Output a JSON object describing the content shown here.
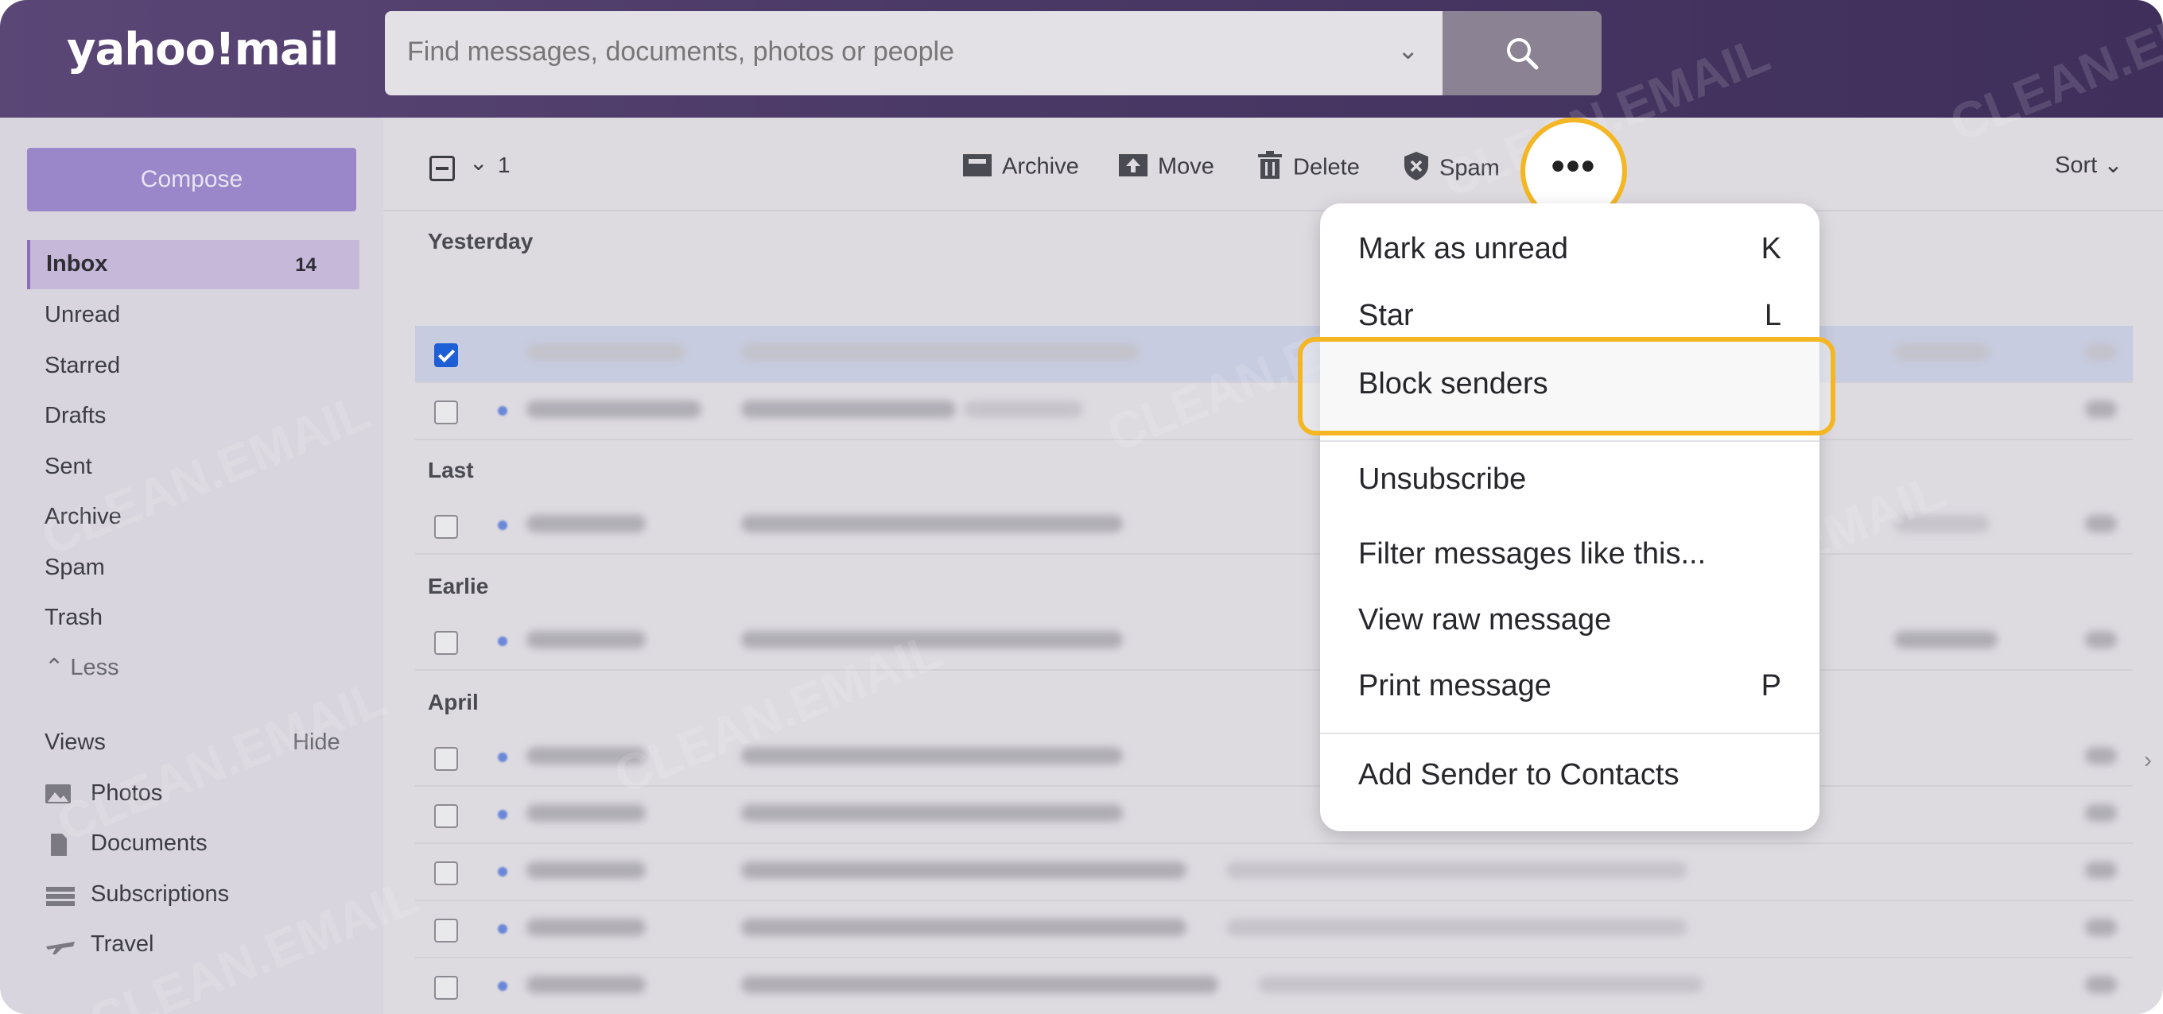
{
  "header": {
    "logo": "yahoo!mail",
    "search_placeholder": "Find messages, documents, photos or people"
  },
  "sidebar": {
    "compose": "Compose",
    "inbox": {
      "label": "Inbox",
      "count": "14"
    },
    "folders": [
      "Unread",
      "Starred",
      "Drafts",
      "Sent",
      "Archive",
      "Spam",
      "Trash"
    ],
    "less": "Less",
    "views_label": "Views",
    "hide": "Hide",
    "views": [
      {
        "label": "Photos",
        "icon": "photos-icon"
      },
      {
        "label": "Documents",
        "icon": "document-icon"
      },
      {
        "label": "Subscriptions",
        "icon": "subscriptions-icon"
      },
      {
        "label": "Travel",
        "icon": "plane-icon"
      }
    ]
  },
  "toolbar": {
    "selected_count": "1",
    "archive": "Archive",
    "move": "Move",
    "delete": "Delete",
    "spam": "Spam",
    "more": "•••",
    "sort": "Sort"
  },
  "groups": [
    "Yesterday",
    "Last",
    "Earlie",
    "April"
  ],
  "menu": {
    "items": [
      {
        "label": "Mark as unread",
        "shortcut": "K"
      },
      {
        "label": "Star",
        "shortcut": "L"
      },
      {
        "label": "Block senders",
        "shortcut": ""
      },
      {
        "label": "Unsubscribe",
        "shortcut": ""
      },
      {
        "label": "Filter messages like this...",
        "shortcut": ""
      },
      {
        "label": "View raw message",
        "shortcut": ""
      },
      {
        "label": "Print message",
        "shortcut": "P"
      },
      {
        "label": "Add Sender to Contacts",
        "shortcut": ""
      }
    ]
  },
  "watermark": "CLEAN.EMAIL",
  "colors": {
    "header_purple": "#4a3866",
    "compose_purple": "#9a87c9",
    "highlight_yellow": "#f5b623",
    "checkbox_blue": "#1f5fd6"
  }
}
